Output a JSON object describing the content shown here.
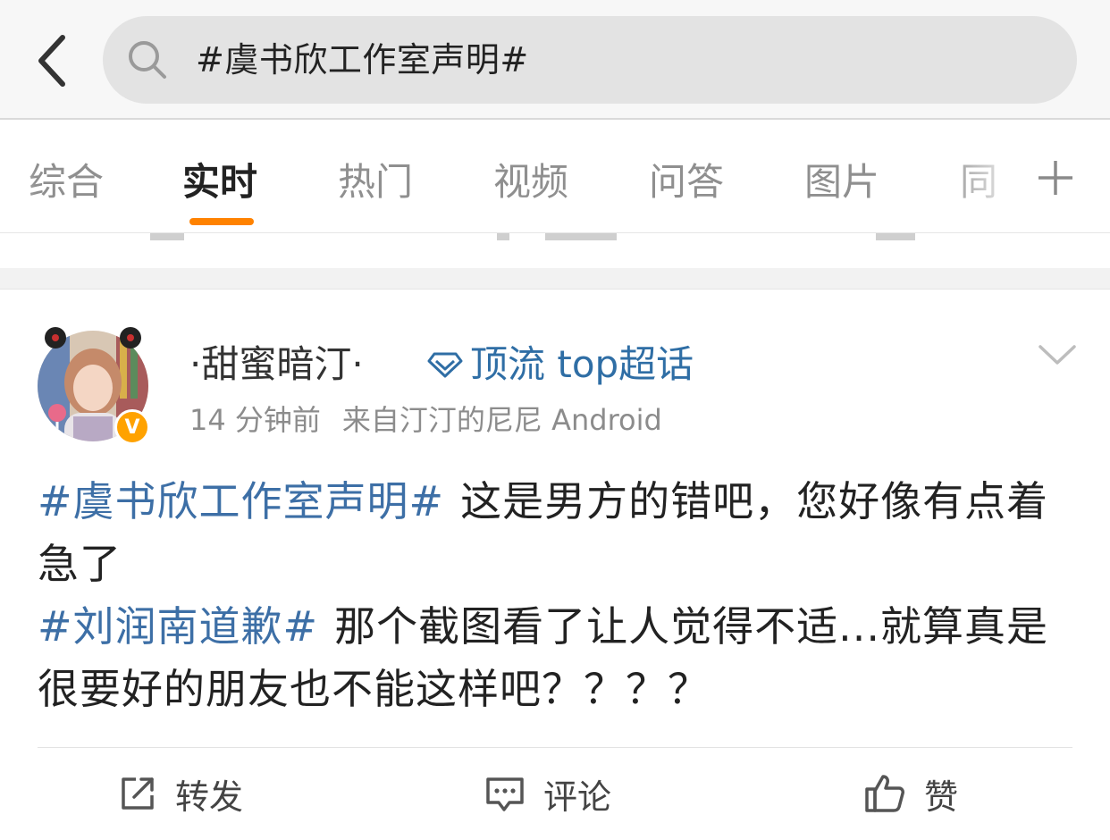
{
  "search": {
    "query": "#虞书欣工作室声明#"
  },
  "tabs": [
    {
      "label": "综合"
    },
    {
      "label": "实时"
    },
    {
      "label": "热门"
    },
    {
      "label": "视频"
    },
    {
      "label": "问答"
    },
    {
      "label": "图片"
    },
    {
      "label": "同"
    }
  ],
  "active_tab": "实时",
  "accent_color": "#ff8200",
  "link_color": "#3d6fa6",
  "post": {
    "username": "·甜蜜暗汀·",
    "supertopic": "顶流 top超话",
    "time": "14 分钟前",
    "source": "来自汀汀的尼尼 Android",
    "verified_badge": "V",
    "lines": [
      {
        "tag": "#虞书欣工作室声明#",
        "text": "这是男方的错吧，您好像有点着急了"
      },
      {
        "tag": "#刘润南道歉#",
        "text": "那个截图看了让人觉得不适...就算真是很要好的朋友也不能这样吧？？？？"
      }
    ]
  },
  "actions": {
    "repost": "转发",
    "comment": "评论",
    "like": "赞"
  },
  "icons": [
    "back-chevron-icon",
    "search-icon",
    "plus-icon",
    "diamond-icon",
    "chevron-down-icon",
    "repost-icon",
    "comment-icon",
    "like-icon"
  ]
}
